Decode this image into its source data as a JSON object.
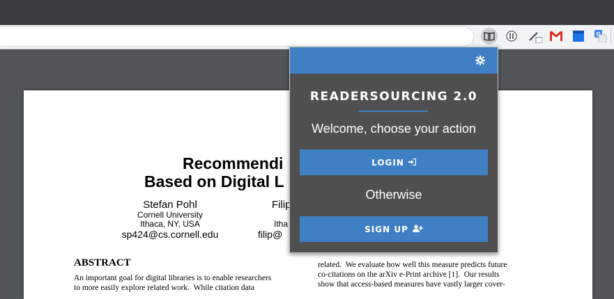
{
  "extension_popup": {
    "title": "READERSOURCING 2.0",
    "welcome_text": "Welcome, choose your action",
    "login_label": "LOGIN",
    "otherwise_text": "Otherwise",
    "signup_label": "SIGN UP",
    "accent_color": "#3f7fc3",
    "background_color": "#4f4f4f",
    "icons": [
      "gear-icon",
      "sign-in-icon",
      "user-plus-icon"
    ]
  },
  "browser": {
    "extensions": [
      "readersourcing-book-icon",
      "round-extension-icon",
      "pen-extension-icon",
      "gmail-icon",
      "calendar-extension-icon",
      "translate-icon"
    ]
  },
  "pdf": {
    "title_line1": "Recommendi",
    "title_line2": "Based on Digital L",
    "author1": {
      "name": "Stefan Pohl",
      "affiliation": "Cornell University",
      "location": "Ithaca, NY, USA",
      "email": "sp424@cs.cornell.edu"
    },
    "author2": {
      "name": "Filip",
      "location": "Itha",
      "email": "filip@"
    },
    "abstract_heading": "ABSTRACT",
    "left_col_line1": "An important goal for digital libraries is to enable researchers",
    "left_col_line2": "to more easily explore related work.  While citation data",
    "right_col_line1": "related.  We evaluate how well this measure predicts future",
    "right_col_line2": "co-citations on the arXiv e-Print archive [1].  Our results",
    "right_col_line3": "show that access-based measures have vastly larger cover-"
  }
}
